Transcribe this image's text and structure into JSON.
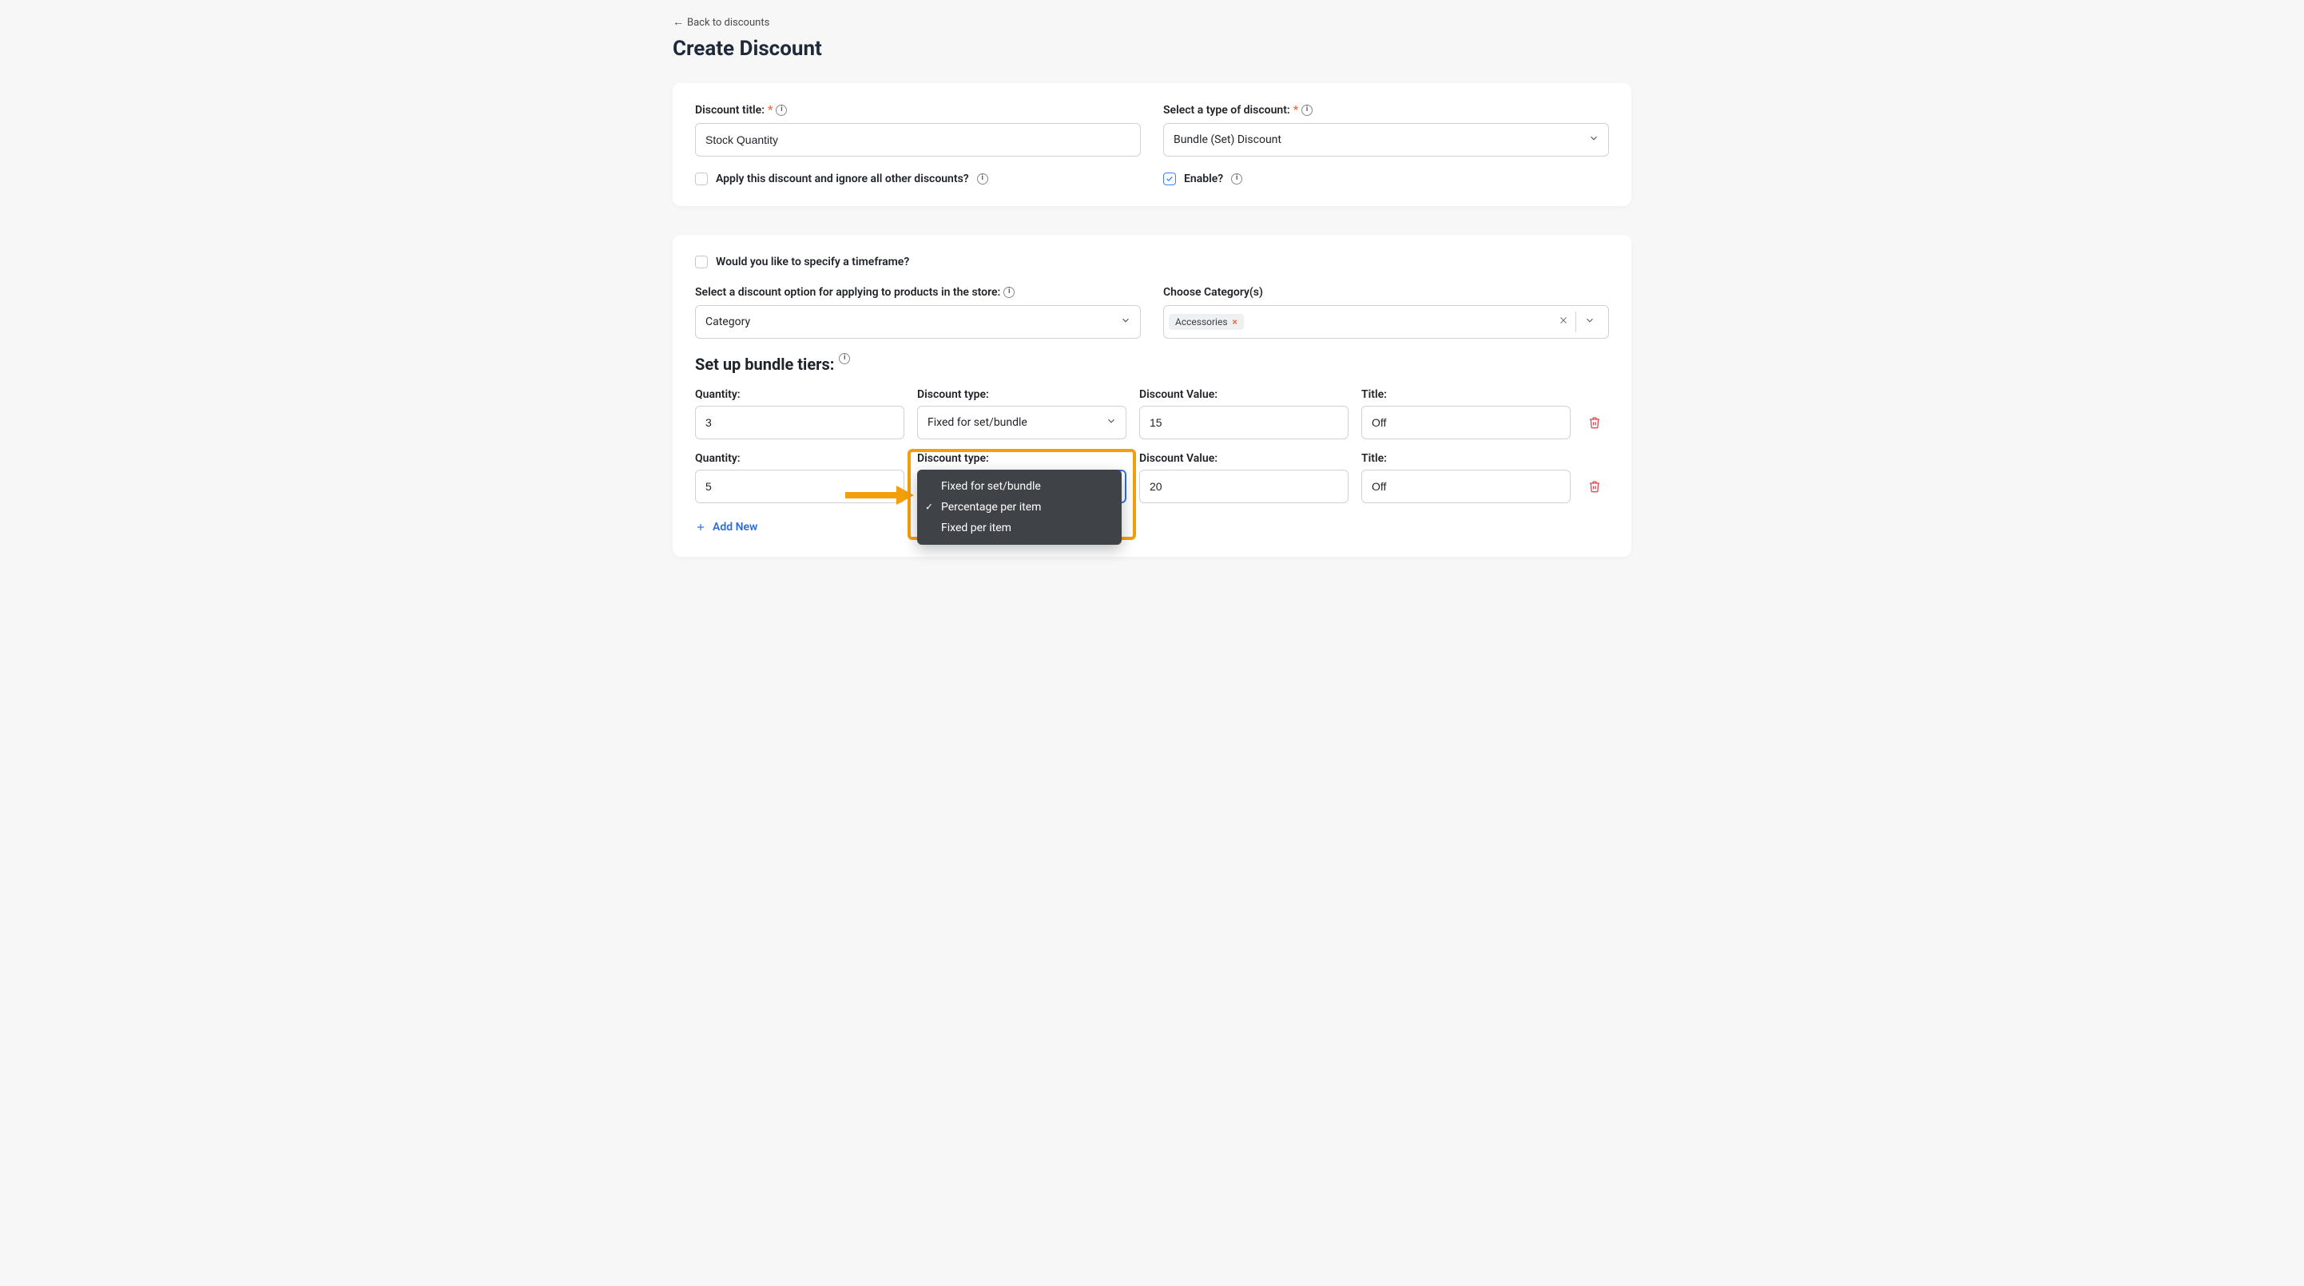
{
  "nav": {
    "back": "Back to discounts"
  },
  "header": {
    "title": "Create Discount"
  },
  "card1": {
    "title_label": "Discount title:",
    "title_value": "Stock Quantity",
    "type_label": "Select a type of discount:",
    "type_value": "Bundle (Set) Discount",
    "apply_ignore_label": "Apply this discount and ignore all other discounts?",
    "apply_ignore_checked": false,
    "enable_label": "Enable?",
    "enable_checked": true
  },
  "card2": {
    "timeframe_label": "Would you like to specify a timeframe?",
    "timeframe_checked": false,
    "option_label": "Select a discount option for applying to products in the store:",
    "option_value": "Category",
    "category_label": "Choose Category(s)",
    "category_tag": "Accessories",
    "section_title": "Set up bundle tiers:",
    "cols": {
      "quantity": "Quantity:",
      "dtype": "Discount type:",
      "dvalue": "Discount Value:",
      "title": "Title:"
    },
    "tiers": [
      {
        "qty": "3",
        "dtype": "Fixed for set/bundle",
        "dvalue": "15",
        "title": "Off"
      },
      {
        "qty": "5",
        "dtype": "Percentage per item",
        "dvalue": "20",
        "title": "Off"
      }
    ],
    "popup_options": [
      "Fixed for set/bundle",
      "Percentage per item",
      "Fixed per item"
    ],
    "add_new": "Add New"
  }
}
